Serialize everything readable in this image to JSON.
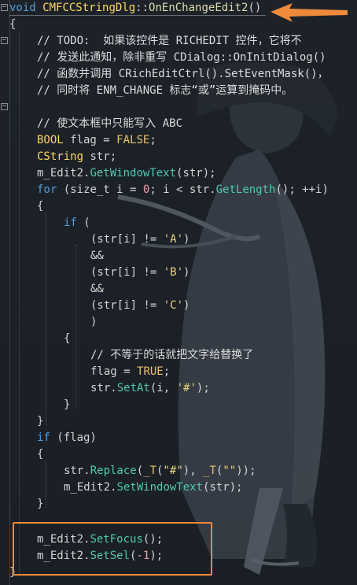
{
  "code": {
    "lines": [
      [
        "void ",
        "CMFCCStringDlg",
        "::",
        "OnEnChangeEdit2",
        "()"
      ],
      [
        "{"
      ],
      [
        "// TODO:  如果该控件是 RICHEDIT 控件，它将不"
      ],
      [
        "// 发送此通知，除非重写 CDialog::OnInitDialog()"
      ],
      [
        "// 函数并调用 CRichEditCtrl().SetEventMask()，"
      ],
      [
        "// 同时将 ENM_CHANGE 标志“或”运算到掩码中。"
      ],
      [
        ""
      ],
      [
        "// 使文本框中只能写入 ABC"
      ],
      [
        "BOOL",
        " flag = ",
        "FALSE",
        ";"
      ],
      [
        "CString",
        " str;"
      ],
      [
        "m_Edit2.",
        "GetWindowText",
        "(str);"
      ],
      [
        "for",
        " (size_t i = ",
        "0",
        "; i < str.",
        "GetLength",
        "(); ++i)"
      ],
      [
        "{"
      ],
      [
        "if",
        " ("
      ],
      [
        "(str[i] != ",
        "'A'",
        ")"
      ],
      [
        "&&"
      ],
      [
        "(str[i] != ",
        "'B'",
        ")"
      ],
      [
        "&&"
      ],
      [
        "(str[i] != ",
        "'C'",
        ")"
      ],
      [
        ")"
      ],
      [
        "{"
      ],
      [
        "// 不等于的话就把文字给替换了"
      ],
      [
        "flag = ",
        "TRUE",
        ";"
      ],
      [
        "str.",
        "SetAt",
        "(i, ",
        "'#'",
        ");"
      ],
      [
        "}"
      ],
      [
        "}"
      ],
      [
        "if",
        " (flag)"
      ],
      [
        "{"
      ],
      [
        "str.",
        "Replace",
        "(",
        "_T",
        "(",
        "\"#\"",
        "), ",
        "_T",
        "(",
        "\"\"",
        "));"
      ],
      [
        "m_Edit2.",
        "SetWindowText",
        "(str);"
      ],
      [
        "}"
      ],
      [
        ""
      ],
      [
        "m_Edit2.",
        "SetFocus",
        "();"
      ],
      [
        "m_Edit2.",
        "SetSel",
        "(",
        "-1",
        ");"
      ],
      [
        "}"
      ]
    ]
  },
  "colors": {
    "background": "#1b2027",
    "keyword": "#569cd6",
    "function": "#4ec9b0",
    "annotation": "#ef8a3a"
  },
  "icons": [
    "fold-minus-icon",
    "arrow-annotation-icon"
  ]
}
